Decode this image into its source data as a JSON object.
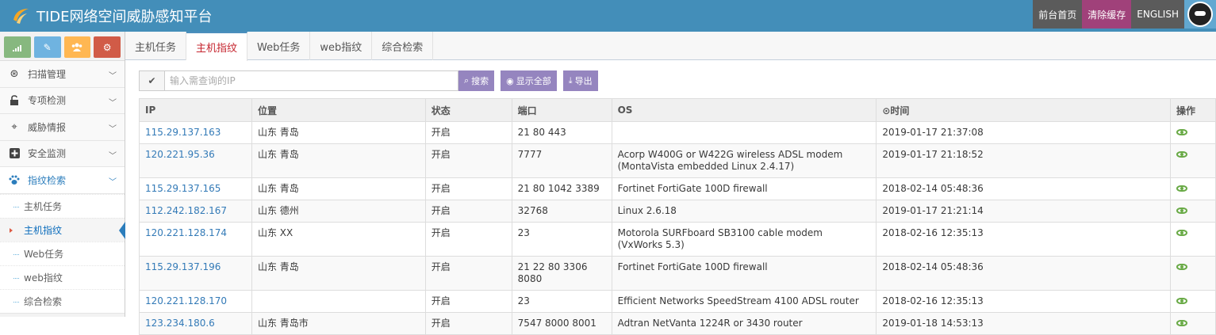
{
  "header": {
    "title": "TIDE网络空间威胁感知平台",
    "front_page": "前台首页",
    "clear_cache": "清除缓存",
    "language": "ENGLISH"
  },
  "sidebar": {
    "shortcuts": [
      "signal-icon",
      "pencil-icon",
      "users-icon",
      "cogs-icon"
    ],
    "menu": [
      {
        "label": "扫描管理",
        "icon": "scan-icon"
      },
      {
        "label": "专项检测",
        "icon": "unlock-icon"
      },
      {
        "label": "威胁情报",
        "icon": "crosshair-icon"
      },
      {
        "label": "安全监测",
        "icon": "plus-square-icon"
      },
      {
        "label": "指纹检索",
        "icon": "paw-icon"
      }
    ],
    "submenu": [
      {
        "label": "主机任务"
      },
      {
        "label": "主机指纹"
      },
      {
        "label": "Web任务"
      },
      {
        "label": "web指纹"
      },
      {
        "label": "综合检索"
      }
    ]
  },
  "tabs": [
    "主机任务",
    "主机指纹",
    "Web任务",
    "web指纹",
    "综合检索"
  ],
  "search": {
    "placeholder": "输入需查询的IP",
    "search_label": "搜索",
    "show_all_label": "显示全部",
    "export_label": "导出"
  },
  "table": {
    "headers": {
      "ip": "IP",
      "location": "位置",
      "status": "状态",
      "port": "端口",
      "os": "OS",
      "time": "时间",
      "action": "操作"
    },
    "rows": [
      {
        "ip": "115.29.137.163",
        "location": "山东 青岛",
        "status": "开启",
        "port": "21 80 443",
        "os": "",
        "time": "2019-01-17 21:37:08"
      },
      {
        "ip": "120.221.95.36",
        "location": "山东 青岛",
        "status": "开启",
        "port": "7777",
        "os": "Acorp W400G or W422G wireless ADSL modem (MontaVista embedded Linux 2.4.17)",
        "time": "2019-01-17 21:18:52"
      },
      {
        "ip": "115.29.137.165",
        "location": "山东 青岛",
        "status": "开启",
        "port": "21 80 1042 3389",
        "os": "Fortinet FortiGate 100D firewall",
        "time": "2018-02-14 05:48:36"
      },
      {
        "ip": "112.242.182.167",
        "location": "山东 德州",
        "status": "开启",
        "port": "32768",
        "os": "Linux 2.6.18",
        "time": "2019-01-17 21:21:14"
      },
      {
        "ip": "120.221.128.174",
        "location": "山东 XX",
        "status": "开启",
        "port": "23",
        "os": "Motorola SURFboard SB3100 cable modem (VxWorks 5.3)",
        "time": "2018-02-16 12:35:13"
      },
      {
        "ip": "115.29.137.196",
        "location": "山东 青岛",
        "status": "开启",
        "port": "21 22 80 3306 8080",
        "os": "Fortinet FortiGate 100D firewall",
        "time": "2018-02-14 05:48:36"
      },
      {
        "ip": "120.221.128.170",
        "location": "",
        "status": "开启",
        "port": "23",
        "os": "Efficient Networks SpeedStream 4100 ADSL router",
        "time": "2018-02-16 12:35:13"
      },
      {
        "ip": "123.234.180.6",
        "location": "山东 青岛市",
        "status": "开启",
        "port": "7547 8000 8001",
        "os": "Adtran NetVanta 1224R or 3430 router",
        "time": "2019-01-18 14:53:13"
      }
    ]
  },
  "colors": {
    "navbar": "#438eb9",
    "accent_tab": "#c5242e",
    "link": "#337ab7",
    "purple_button": "#9585bf",
    "eye_icon": "#69aa46"
  }
}
